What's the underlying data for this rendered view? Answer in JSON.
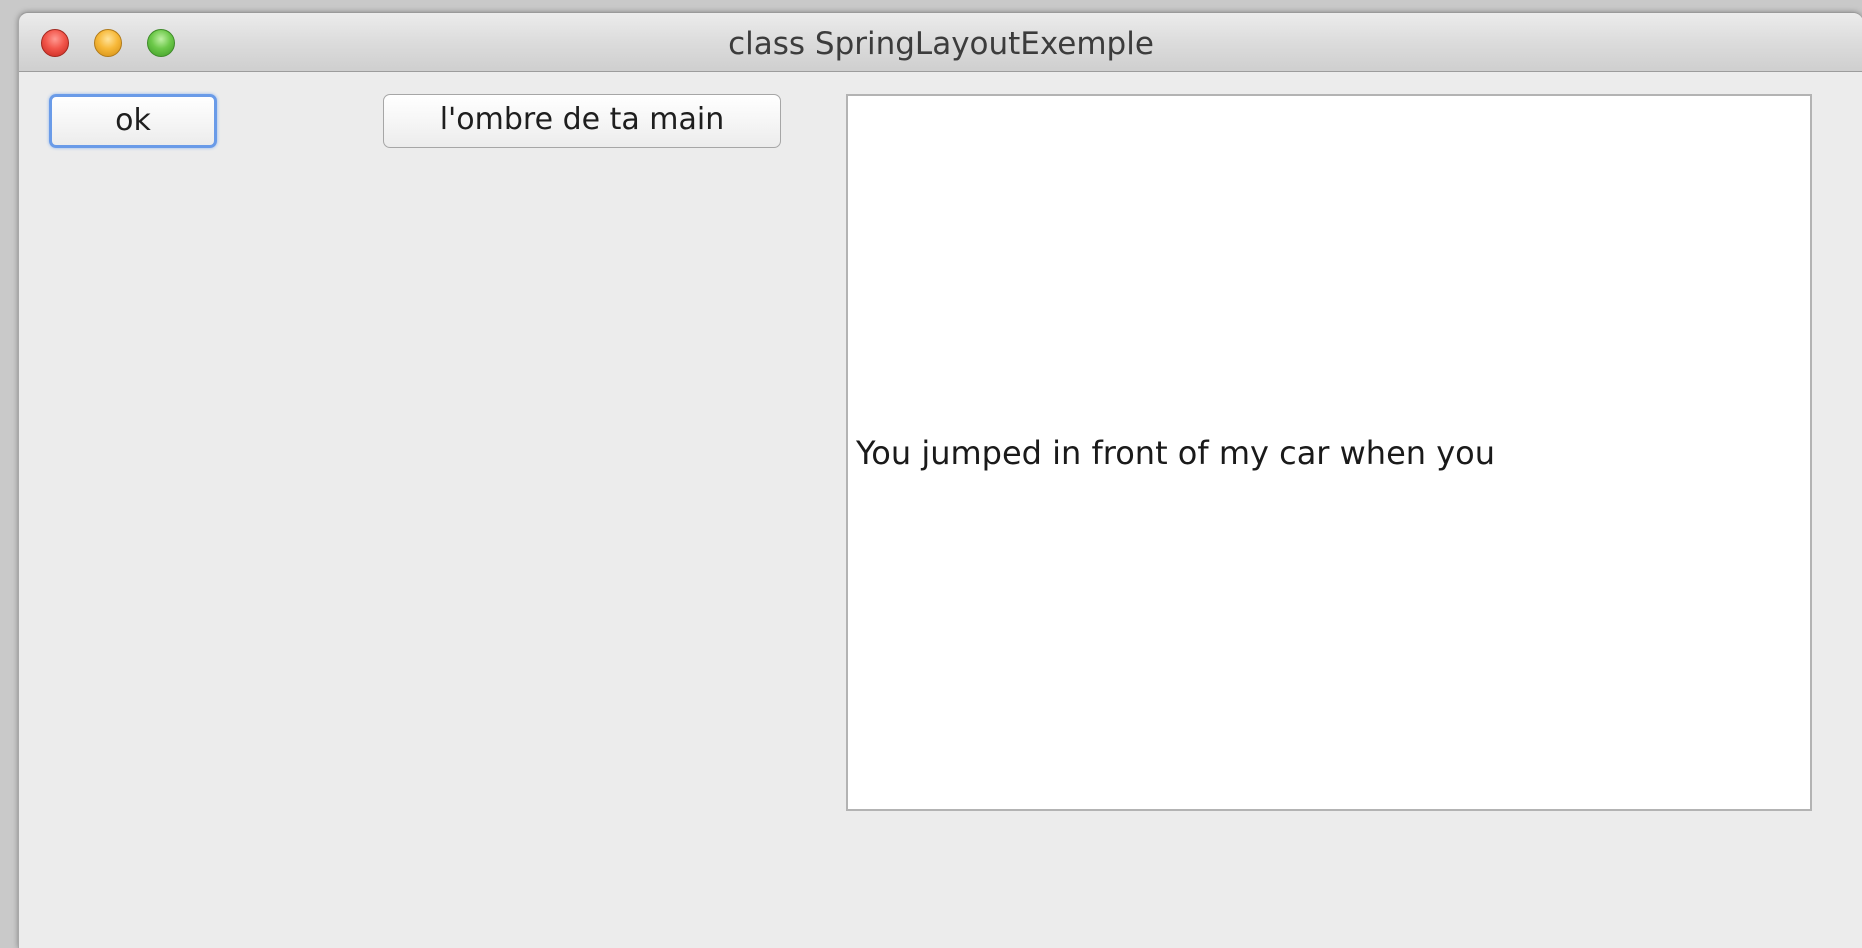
{
  "window": {
    "title": "class SpringLayoutExemple"
  },
  "titlebar_buttons": {
    "close_icon": "close-traffic-light",
    "minimize_icon": "minimize-traffic-light",
    "zoom_icon": "zoom-traffic-light",
    "colors": {
      "close": "#f2564b",
      "minimize": "#f7b93a",
      "zoom": "#6dc94a"
    }
  },
  "buttons": {
    "ok_label": "ok",
    "ombre_label": "l'ombre de ta main"
  },
  "text_area": {
    "content": "You jumped in front of my car when you"
  },
  "colors": {
    "window_background": "#ececec",
    "focus_ring": "#6a9be8",
    "text_area_background": "#ffffff"
  }
}
